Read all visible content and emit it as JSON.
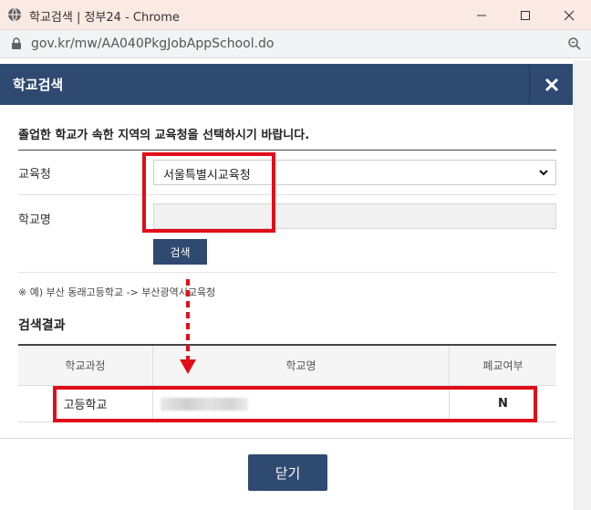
{
  "window": {
    "title": "학교검색 | 정부24 - Chrome"
  },
  "address_bar": {
    "url": "gov.kr/mw/AA040PkgJobAppSchool.do"
  },
  "popup": {
    "title": "학교검색",
    "instruction": "졸업한 학교가 속한 지역의 교육청을 선택하시기 바랍니다.",
    "form": {
      "edu_office_label": "교육청",
      "edu_office_value": "서울특별시교육청",
      "school_name_label": "학교명",
      "school_name_value": "",
      "search_button": "검색"
    },
    "note": "※ 예) 부산 동래고등학교 -> 부산광역시교육청",
    "results": {
      "title": "검색결과",
      "headers": [
        "학교과정",
        "학교명",
        "폐교여부"
      ],
      "rows": [
        {
          "course": "고등학교",
          "name": "",
          "closed": "N"
        }
      ]
    },
    "close_button": "닫기"
  },
  "colors": {
    "header_bg": "#2f4a70",
    "annotation_red": "#e10d18",
    "titlebar_bg": "#fbe9e3"
  }
}
